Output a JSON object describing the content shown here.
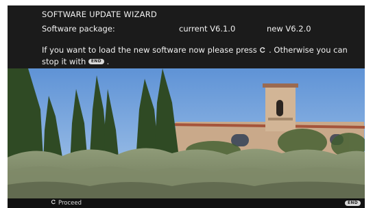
{
  "wizard": {
    "title": "SOFTWARE UPDATE WIZARD",
    "package_label": "Software package:",
    "current_version": "current V6.1.0",
    "new_version": "new V6.2.0",
    "message_part1": "If you want to load the new software now please press",
    "message_part2": ". Otherwise you can stop it with",
    "message_part3": "."
  },
  "keys": {
    "end_label": "END",
    "confirm_icon": "confirm-icon"
  },
  "footer": {
    "proceed_label": "Proceed",
    "end_label": "END"
  },
  "colors": {
    "panel_bg": "#1b1b1b",
    "text": "#f2f2f2",
    "sky": "#6f9fd8"
  }
}
